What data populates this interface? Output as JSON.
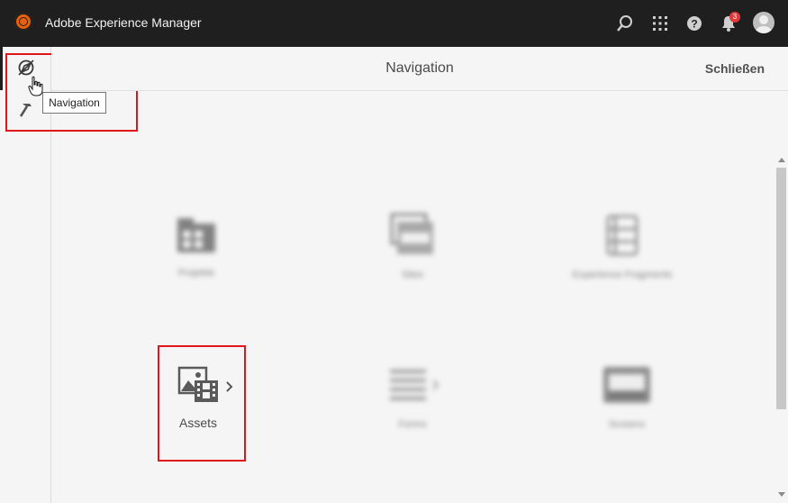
{
  "app": {
    "title": "Adobe Experience Manager",
    "logo_icon": "adobe-aem-logo-icon"
  },
  "topbar": {
    "icons": [
      "search-icon",
      "apps-grid-icon",
      "help-icon",
      "bell-icon",
      "user-avatar"
    ],
    "notifications_count": "3"
  },
  "sidebar": {
    "items": [
      {
        "name": "navigation",
        "icon": "compass-icon",
        "active": true
      },
      {
        "name": "tools",
        "icon": "hammer-icon",
        "active": false
      }
    ],
    "tooltip": "Navigation"
  },
  "header": {
    "title": "Navigation",
    "close_label": "Schließen"
  },
  "tiles": [
    {
      "id": "projects",
      "icon": "folder-grid-icon",
      "label": "Projekte",
      "blurred": true
    },
    {
      "id": "sites",
      "icon": "sites-icon",
      "label": "Sites",
      "blurred": true
    },
    {
      "id": "fragments",
      "icon": "experience-fragment-icon",
      "label": "Experience Fragments",
      "blurred": true
    },
    {
      "id": "assets",
      "icon": "assets-icon",
      "label": "Assets",
      "blurred": false,
      "has_children": true
    },
    {
      "id": "forms",
      "icon": "forms-list-icon",
      "label": "Forms",
      "blurred": true
    },
    {
      "id": "screens",
      "icon": "screens-icon",
      "label": "Screens",
      "blurred": true
    }
  ],
  "colors": {
    "topbar": "#1f1f1f",
    "highlight": "#e0161b",
    "badge": "#e23a3a",
    "background": "#f5f5f5"
  }
}
